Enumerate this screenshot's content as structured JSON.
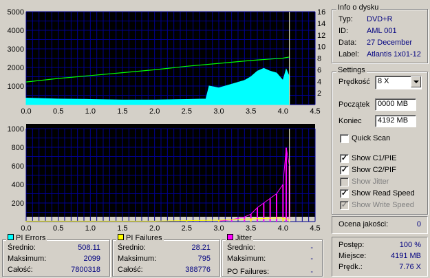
{
  "info": {
    "title": "Info o dysku",
    "rows": [
      {
        "label": "Typ:",
        "value": "DVD+R"
      },
      {
        "label": "ID:",
        "value": "AML 001"
      },
      {
        "label": "Data:",
        "value": "27 December"
      },
      {
        "label": "Label:",
        "value": "Atlantis 1x01-12"
      }
    ]
  },
  "settings": {
    "title": "Settings",
    "speed_label": "Prędkość",
    "speed_value": "8 X",
    "start_label": "Początek",
    "start_value": "0000 MB",
    "end_label": "Koniec",
    "end_value": "4192 MB",
    "quick_scan": "Quick Scan",
    "checkboxes": [
      {
        "label": "Show C1/PIE",
        "checked": true,
        "enabled": true
      },
      {
        "label": "Show C2/PIF",
        "checked": true,
        "enabled": true
      },
      {
        "label": "Show Jitter",
        "checked": false,
        "enabled": false
      },
      {
        "label": "Show Read Speed",
        "checked": true,
        "enabled": true
      },
      {
        "label": "Show Write Speed",
        "checked": true,
        "enabled": false
      }
    ]
  },
  "quality": {
    "label": "Ocena jakości:",
    "value": "0"
  },
  "progress": {
    "rows": [
      {
        "label": "Postęp:",
        "value": "100 %"
      },
      {
        "label": "Miejsce:",
        "value": "4191 MB"
      },
      {
        "label": "Prędk.:",
        "value": "7.76 X"
      }
    ]
  },
  "pi_errors": {
    "title": "PI Errors",
    "color": "#00ffff",
    "rows": [
      {
        "label": "Średnio:",
        "value": "508.11"
      },
      {
        "label": "Maksimum:",
        "value": "2099"
      },
      {
        "label": "Całość:",
        "value": "7800318"
      }
    ]
  },
  "pi_failures": {
    "title": "PI Failures",
    "color": "#ffff00",
    "rows": [
      {
        "label": "Średnio:",
        "value": "28.21"
      },
      {
        "label": "Maksimum:",
        "value": "795"
      },
      {
        "label": "Całość:",
        "value": "388776"
      }
    ]
  },
  "jitter": {
    "title": "Jitter",
    "color": "#ff00ff",
    "rows": [
      {
        "label": "Średnio:",
        "value": "-"
      },
      {
        "label": "Maksimum:",
        "value": "-"
      }
    ],
    "po_label": "PO Failures:",
    "po_value": "-"
  },
  "chart_data": [
    {
      "type": "area",
      "x_ticks": [
        "0.0",
        "0.5",
        "1.0",
        "1.5",
        "2.0",
        "2.5",
        "3.0",
        "3.5",
        "4.0",
        "4.5"
      ],
      "y_ticks_left": [
        "5000",
        "4000",
        "3000",
        "2000",
        "1000"
      ],
      "y_ticks_right": [
        "16",
        "14",
        "12",
        "10",
        "8",
        "6",
        "4",
        "2"
      ],
      "xlim": [
        0,
        4.5
      ],
      "ylim": [
        0,
        5000
      ],
      "y2lim": [
        0,
        16
      ],
      "grid": true,
      "series": [
        {
          "color": "#00ffff",
          "points": [
            [
              0,
              350
            ],
            [
              0.5,
              300
            ],
            [
              1.0,
              280
            ],
            [
              1.5,
              250
            ],
            [
              2.0,
              250
            ],
            [
              2.5,
              280
            ],
            [
              2.8,
              300
            ],
            [
              2.85,
              1000
            ],
            [
              3.0,
              900
            ],
            [
              3.2,
              1100
            ],
            [
              3.4,
              1300
            ],
            [
              3.5,
              1500
            ],
            [
              3.6,
              1800
            ],
            [
              3.7,
              1950
            ],
            [
              3.8,
              1800
            ],
            [
              3.9,
              1700
            ],
            [
              4.0,
              1300
            ],
            [
              4.05,
              1900
            ],
            [
              4.1,
              1500
            ]
          ]
        },
        {
          "color": "#00ff00",
          "points": [
            [
              0,
              3.9
            ],
            [
              0.5,
              4.5
            ],
            [
              1.0,
              5.0
            ],
            [
              1.5,
              5.5
            ],
            [
              2.0,
              6.0
            ],
            [
              2.5,
              6.6
            ],
            [
              3.0,
              7.1
            ],
            [
              3.5,
              7.6
            ],
            [
              4.0,
              8.0
            ],
            [
              4.1,
              8.2
            ]
          ]
        }
      ],
      "marker_x": 4.1
    },
    {
      "type": "bar",
      "x_ticks": [
        "0.0",
        "0.5",
        "1.0",
        "1.5",
        "2.0",
        "2.5",
        "3.0",
        "3.5",
        "4.0",
        "4.5"
      ],
      "y_ticks_left": [
        "1000",
        "800",
        "600",
        "400",
        "200"
      ],
      "xlim": [
        0,
        4.5
      ],
      "ylim": [
        0,
        1000
      ],
      "grid": true,
      "series": [
        {
          "color": "#ff00ff",
          "points": [
            [
              3.0,
              5
            ],
            [
              3.2,
              20
            ],
            [
              3.4,
              50
            ],
            [
              3.5,
              80
            ],
            [
              3.6,
              150
            ],
            [
              3.7,
              200
            ],
            [
              3.8,
              250
            ],
            [
              3.9,
              300
            ],
            [
              4.0,
              400
            ],
            [
              4.05,
              795
            ],
            [
              4.1,
              600
            ]
          ]
        },
        {
          "color": "#ffff00",
          "points": [
            [
              0,
              5
            ],
            [
              1.0,
              5
            ],
            [
              2.0,
              5
            ],
            [
              2.5,
              10
            ],
            [
              3.0,
              15
            ],
            [
              3.5,
              30
            ],
            [
              4.0,
              40
            ],
            [
              4.1,
              20
            ]
          ]
        }
      ],
      "marker_x": 4.1
    }
  ]
}
